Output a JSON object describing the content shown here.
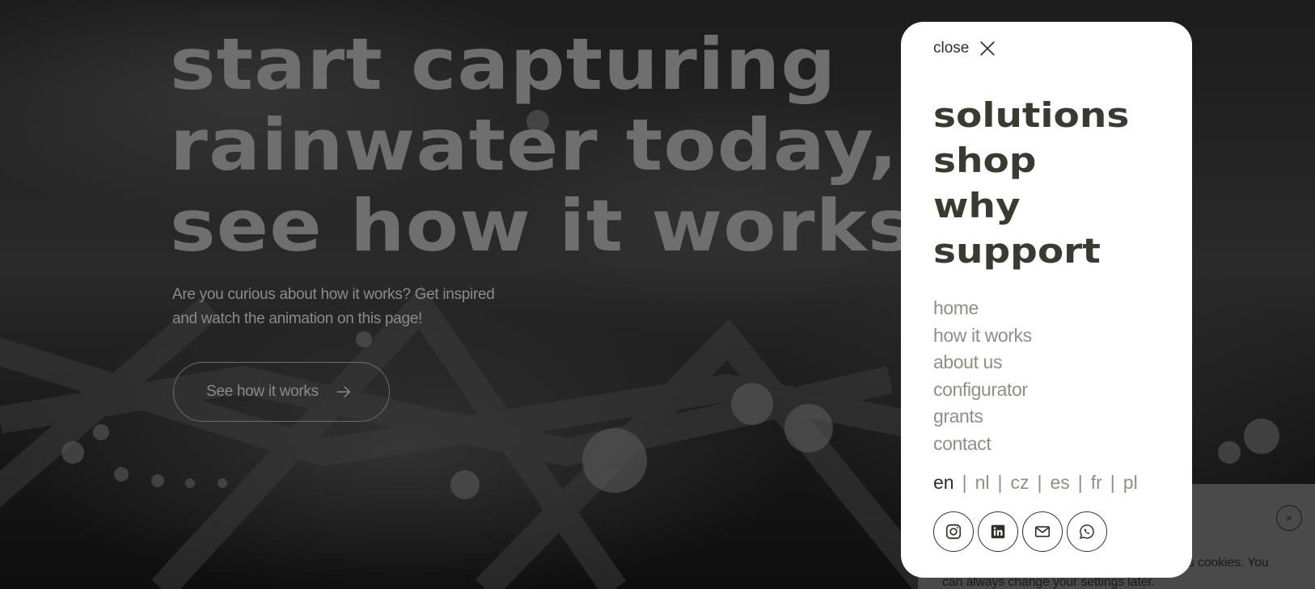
{
  "hero": {
    "title_lines": [
      "start capturing",
      "rainwater today,",
      "see how it works"
    ],
    "subtitle": "Are you curious about how it works? Get inspired and watch the animation on this page!",
    "cta_label": "See how it works"
  },
  "menu": {
    "close_label": "close",
    "primary": [
      "solutions",
      "shop",
      "why",
      "support"
    ],
    "secondary": [
      "home",
      "how it works",
      "about us",
      "configurator",
      "grants",
      "contact"
    ],
    "languages": [
      "en",
      "nl",
      "cz",
      "es",
      "fr",
      "pl"
    ],
    "active_language": "en",
    "socials": [
      "instagram-icon",
      "linkedin-icon",
      "mail-icon",
      "whatsapp-icon"
    ]
  },
  "cookie": {
    "text": "s cookies. You can always change your settings later.",
    "close_symbol": "×"
  },
  "colors": {
    "hero_title": "#6f6f6f",
    "menu_primary": "#3a3a30",
    "menu_secondary": "#8f8f84",
    "panel": "#ffffff"
  }
}
